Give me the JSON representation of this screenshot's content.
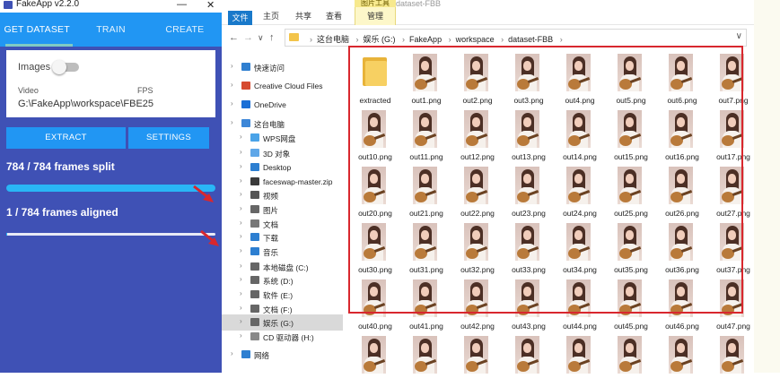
{
  "fakeapp": {
    "title": "FakeApp v2.2.0",
    "window_controls": [
      "—",
      "✕"
    ],
    "tabs": [
      {
        "label": "GET DATASET",
        "active": true
      },
      {
        "label": "TRAIN",
        "active": false
      },
      {
        "label": "CREATE",
        "active": false
      }
    ],
    "images_label": "Images",
    "images_toggle": false,
    "video_label": "Video",
    "fps_label": "FPS",
    "video_path": "G:\\FakeApp\\workspace\\FBE25",
    "extract_label": "EXTRACT",
    "settings_label": "SETTINGS",
    "split_status": "784 / 784 frames split",
    "split_progress": 1.0,
    "aligned_status": "1 / 784 frames aligned",
    "aligned_progress": 0.0013,
    "colors": {
      "bg": "#3f51b5",
      "accent": "#2196f3",
      "split_bar": "#29b6f6",
      "annotation": "#d8272e"
    }
  },
  "explorer": {
    "window_title": "dataset-FBB",
    "context_tab": "图片工具",
    "ribbon_tabs": [
      "文件",
      "主页",
      "共享",
      "查看",
      "管理"
    ],
    "breadcrumb": [
      "这台电脑",
      "娱乐 (G:)",
      "FakeApp",
      "workspace",
      "dataset-FBB"
    ],
    "nav_items": [
      {
        "label": "快速访问",
        "icon": "star-icon",
        "color": "#2f7fd0",
        "indent": 0,
        "selected": false
      },
      {
        "label": "Creative Cloud Files",
        "icon": "creative-cloud-icon",
        "color": "#d64a2f",
        "indent": 0,
        "selected": false
      },
      {
        "label": "OneDrive",
        "icon": "onedrive-icon",
        "color": "#1b6fd6",
        "indent": 0,
        "selected": false
      },
      {
        "label": "这台电脑",
        "icon": "computer-icon",
        "color": "#3d87d8",
        "indent": 0,
        "selected": false
      },
      {
        "label": "WPS网盘",
        "icon": "cloud-icon",
        "color": "#4aa3e8",
        "indent": 1,
        "selected": false
      },
      {
        "label": "3D 对象",
        "icon": "3d-objects-icon",
        "color": "#5fa7e8",
        "indent": 1,
        "selected": false
      },
      {
        "label": "Desktop",
        "icon": "desktop-icon",
        "color": "#2d7fd1",
        "indent": 1,
        "selected": false
      },
      {
        "label": "faceswap-master.zip",
        "icon": "zip-icon",
        "color": "#3a3a3a",
        "indent": 1,
        "selected": false
      },
      {
        "label": "视频",
        "icon": "video-icon",
        "color": "#555555",
        "indent": 1,
        "selected": false
      },
      {
        "label": "图片",
        "icon": "pictures-icon",
        "color": "#666666",
        "indent": 1,
        "selected": false
      },
      {
        "label": "文档",
        "icon": "documents-icon",
        "color": "#777777",
        "indent": 1,
        "selected": false
      },
      {
        "label": "下载",
        "icon": "download-icon",
        "color": "#2d7fd1",
        "indent": 1,
        "selected": false
      },
      {
        "label": "音乐",
        "icon": "music-icon",
        "color": "#2d7fd1",
        "indent": 1,
        "selected": false
      },
      {
        "label": "本地磁盘 (C:)",
        "icon": "drive-icon",
        "color": "#666666",
        "indent": 1,
        "selected": false
      },
      {
        "label": "系统 (D:)",
        "icon": "drive-icon",
        "color": "#666666",
        "indent": 1,
        "selected": false
      },
      {
        "label": "软件 (E:)",
        "icon": "drive-icon",
        "color": "#666666",
        "indent": 1,
        "selected": false
      },
      {
        "label": "文档 (F:)",
        "icon": "drive-icon",
        "color": "#666666",
        "indent": 1,
        "selected": false
      },
      {
        "label": "娱乐 (G:)",
        "icon": "drive-icon",
        "color": "#666666",
        "indent": 1,
        "selected": true
      },
      {
        "label": "CD 驱动器 (H:)",
        "icon": "cd-drive-icon",
        "color": "#888888",
        "indent": 1,
        "selected": false
      },
      {
        "label": "网络",
        "icon": "network-icon",
        "color": "#2d7fd1",
        "indent": 0,
        "selected": false
      }
    ],
    "files": [
      "extracted",
      "out1.png",
      "out2.png",
      "out3.png",
      "out4.png",
      "out5.png",
      "out6.png",
      "out7.png",
      "out10.png",
      "out11.png",
      "out12.png",
      "out13.png",
      "out14.png",
      "out15.png",
      "out16.png",
      "out17.png",
      "out20.png",
      "out21.png",
      "out22.png",
      "out23.png",
      "out24.png",
      "out25.png",
      "out26.png",
      "out27.png",
      "out30.png",
      "out31.png",
      "out32.png",
      "out33.png",
      "out34.png",
      "out35.png",
      "out36.png",
      "out37.png",
      "out40.png",
      "out41.png",
      "out42.png",
      "out43.png",
      "out44.png",
      "out45.png",
      "out46.png",
      "out47.png",
      "",
      "",
      "",
      "",
      "",
      "",
      "",
      ""
    ]
  }
}
